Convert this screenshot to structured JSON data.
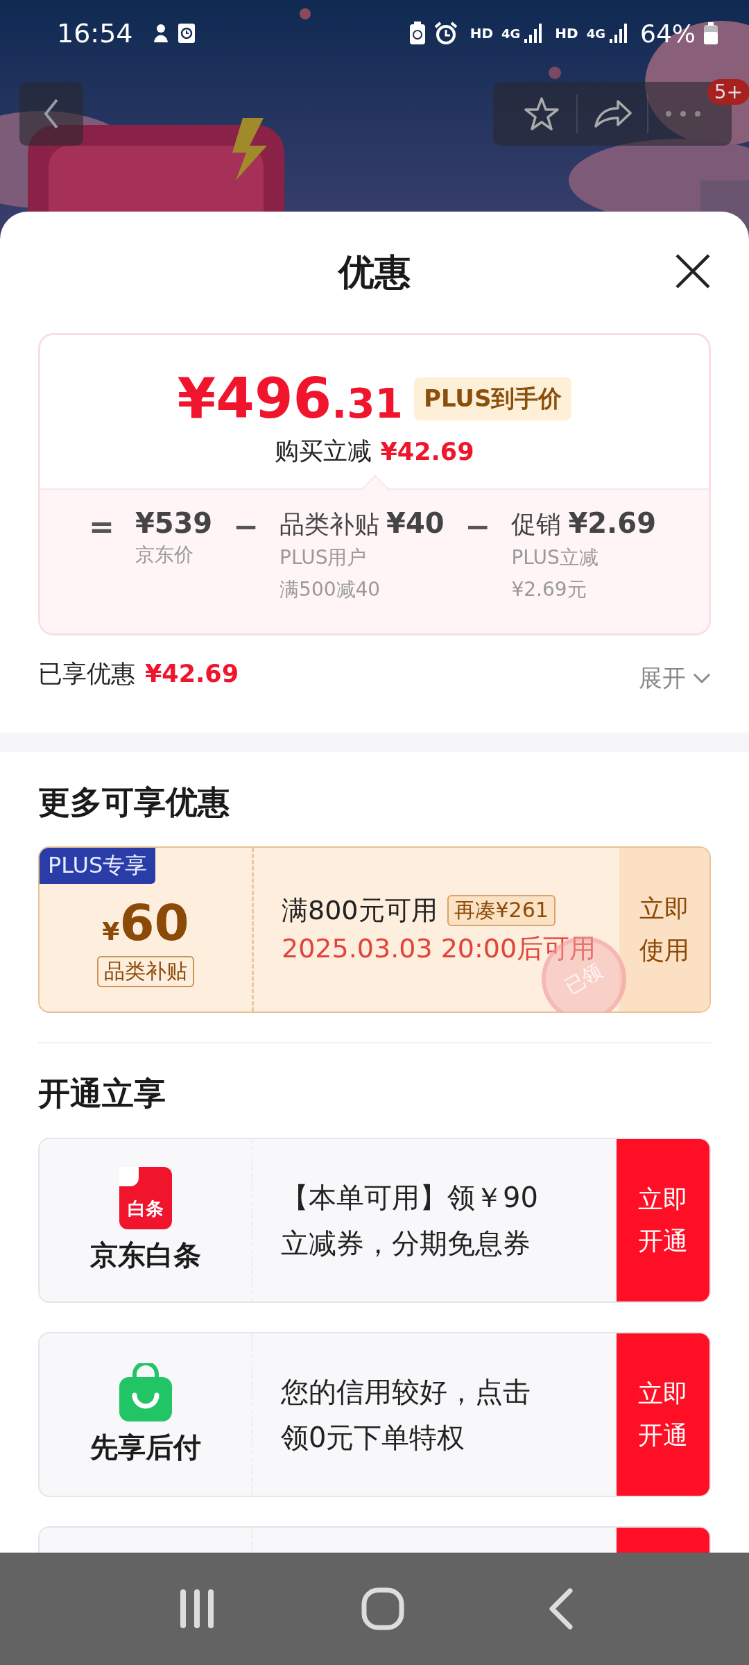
{
  "status_bar": {
    "time": "16:54",
    "networks": [
      {
        "hd": "HD",
        "gen": "4G"
      },
      {
        "hd": "HD",
        "gen": "4G"
      }
    ],
    "battery": "64%"
  },
  "header": {
    "more_badge": "5+"
  },
  "sheet": {
    "title": "优惠"
  },
  "price_card": {
    "price_integer": "¥496",
    "price_decimal": ".31",
    "tag": "PLUS到手价",
    "saving_label": "购买立减",
    "saving_amount": "¥42.69",
    "breakdown": [
      {
        "kind": "operator",
        "symbol": "="
      },
      {
        "kind": "term",
        "amount": "¥539",
        "lines": [
          "京东价"
        ]
      },
      {
        "kind": "operator",
        "symbol": "−"
      },
      {
        "kind": "term",
        "title": "品类补贴",
        "amount": "¥40",
        "lines": [
          "PLUS用户",
          "满500减40"
        ]
      },
      {
        "kind": "operator",
        "symbol": "−"
      },
      {
        "kind": "term",
        "title": "促销",
        "amount": "¥2.69",
        "lines": [
          "PLUS立减",
          "¥2.69元"
        ]
      }
    ]
  },
  "summary": {
    "label": "已享优惠",
    "amount": "¥42.69",
    "toggle": "展开",
    "expanded": false
  },
  "more_offers": {
    "title": "更多可享优惠",
    "coupons": [
      {
        "badge": "PLUS专享",
        "currency": "¥",
        "amount": "60",
        "category": "品类补贴",
        "condition": "满800元可用",
        "hint": "再凑¥261",
        "time": "2025.03.03 20:00后可用",
        "action": "立即使用",
        "stamp": "已领"
      }
    ]
  },
  "open_offers": {
    "title": "开通立享",
    "services": [
      {
        "kind": "document",
        "icon_text": "白条",
        "name": "京东白条",
        "desc": "【本单可用】领￥90立减券，分期免息券",
        "action": "立即开通"
      },
      {
        "kind": "bag",
        "name": "先享后付",
        "desc": "您的信用较好，点击领0元下单特权",
        "action": "立即开通"
      }
    ]
  }
}
